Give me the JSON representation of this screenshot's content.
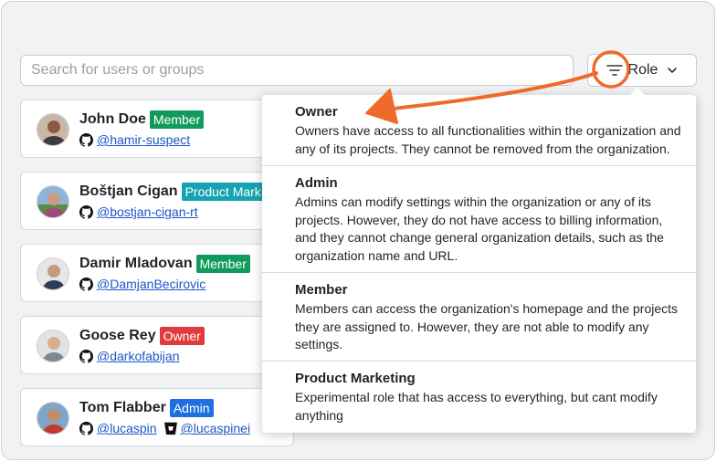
{
  "search": {
    "placeholder": "Search for users or groups"
  },
  "role_filter": {
    "label": "Role",
    "icon": "filter-icon"
  },
  "users": [
    {
      "name": "John Doe",
      "role": "Member",
      "role_color": "#129a5c",
      "handles": [
        {
          "service": "github",
          "text": "@hamir-suspect"
        }
      ]
    },
    {
      "name": "Boštjan Cigan",
      "role": "Product Mark",
      "role_color": "#14a3b0",
      "handles": [
        {
          "service": "github",
          "text": "@bostjan-cigan-rt"
        }
      ]
    },
    {
      "name": "Damir Mladovan",
      "role": "Member",
      "role_color": "#129a5c",
      "handles": [
        {
          "service": "github",
          "text": "@DamjanBecirovic"
        }
      ]
    },
    {
      "name": "Goose Rey",
      "role": "Owner",
      "role_color": "#e23b3b",
      "handles": [
        {
          "service": "github",
          "text": "@darkofabijan"
        }
      ]
    },
    {
      "name": "Tom Flabber",
      "role": "Admin",
      "role_color": "#1f6fe0",
      "handles": [
        {
          "service": "github",
          "text": "@lucaspin"
        },
        {
          "service": "bitbucket",
          "text": "@lucaspinei"
        }
      ]
    }
  ],
  "roles_menu": [
    {
      "title": "Owner",
      "description": "Owners have access to all functionalities within the organization and any of its projects. They cannot be removed from the organization."
    },
    {
      "title": "Admin",
      "description": "Admins can modify settings within the organization or any of its projects. However, they do not have access to billing information, and they cannot change general organization details, such as the organization name and URL."
    },
    {
      "title": "Member",
      "description": "Members can access the organization's homepage and the projects they are assigned to. However, they are not able to modify any settings."
    },
    {
      "title": "Product Marketing",
      "description": "Experimental role that has access to everything, but cant modify anything"
    }
  ],
  "colors": {
    "annotation": "#ef6a2a",
    "link": "#1a56c8"
  }
}
